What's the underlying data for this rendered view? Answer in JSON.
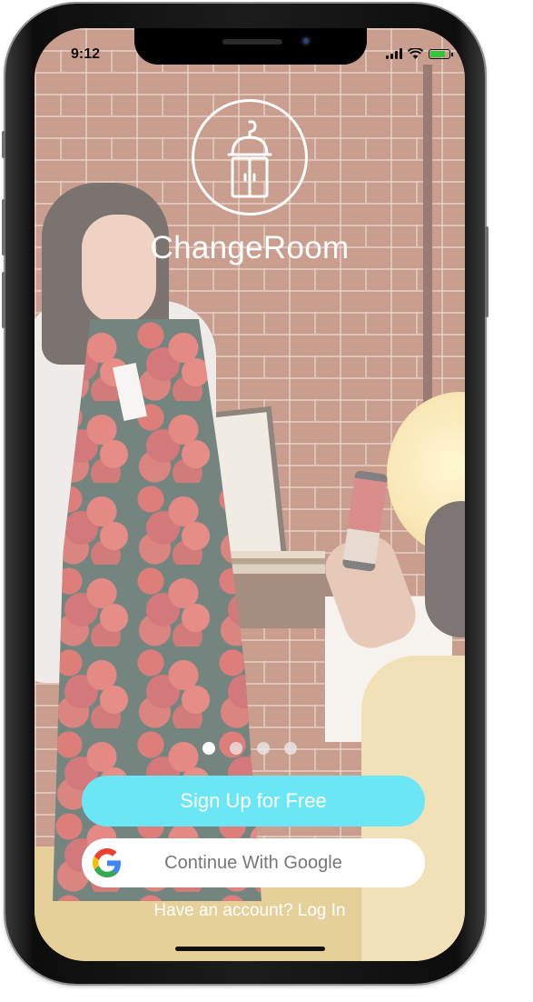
{
  "status_bar": {
    "time": "9:12",
    "signal_icon": "cellular-signal-icon",
    "wifi_icon": "wifi-icon",
    "battery_icon": "battery-charging-icon"
  },
  "brand": {
    "logo_icon": "wardrobe-closet-icon",
    "app_name": "ChangeRoom"
  },
  "carousel": {
    "page_count": 4,
    "active_index": 0
  },
  "actions": {
    "signup_label": "Sign Up for Free",
    "google_label": "Continue With Google",
    "google_icon": "google-g-icon",
    "login_prompt": "Have an account? Log In"
  },
  "colors": {
    "signup_button": "#6be6f5",
    "google_button": "#ffffff",
    "brand_text": "#ffffff"
  }
}
